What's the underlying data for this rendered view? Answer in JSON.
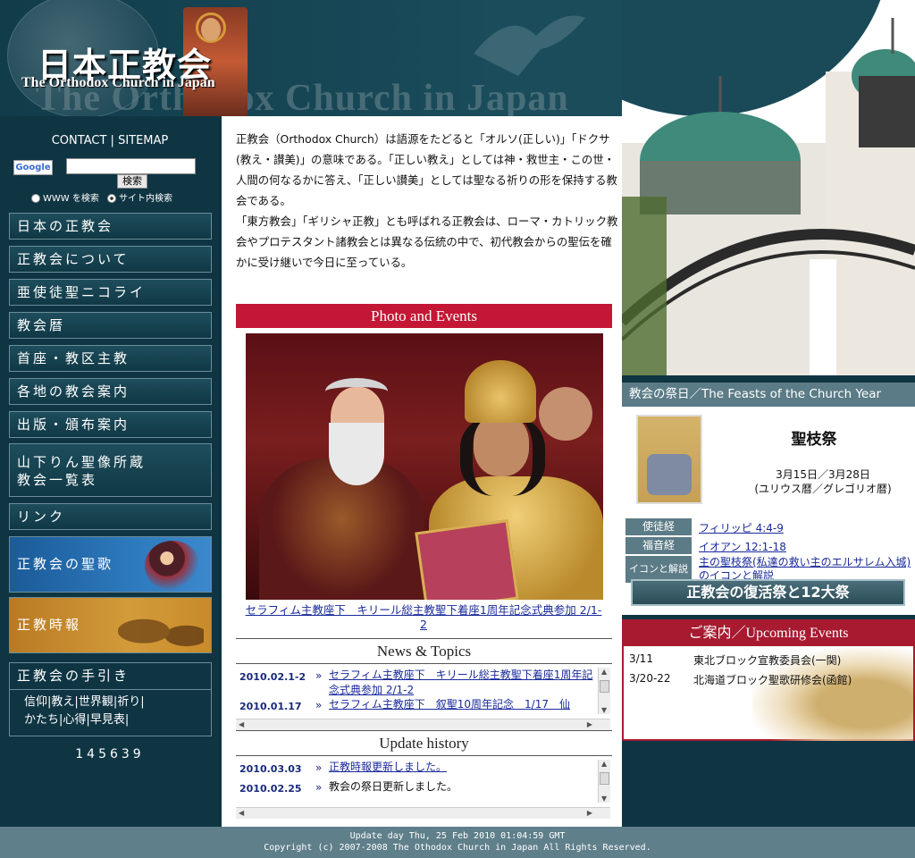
{
  "header": {
    "title_jp": "日本正教会",
    "title_en": "The Orthodox Church in Japan",
    "watermark": "The Orthodox Church in Japan"
  },
  "left_nav": {
    "contact": "CONTACT",
    "separator": "|",
    "sitemap": "SITEMAP",
    "google_logo": "Google",
    "search_value": "",
    "search_button": "検索",
    "radio_www": "WWW を検索",
    "radio_site": "サイト内検索",
    "items": [
      {
        "label": "日本の正教会"
      },
      {
        "label": "正教会について"
      },
      {
        "label": "亜使徒聖ニコライ"
      },
      {
        "label": "教会暦"
      },
      {
        "label": "首座・教区主教"
      },
      {
        "label": "各地の教会案内"
      },
      {
        "label": "出版・頒布案内"
      },
      {
        "label": "山下りん聖像所蔵"
      },
      {
        "label": "教会一覧表"
      },
      {
        "label": "リンク"
      },
      {
        "label": "正教会の聖歌"
      },
      {
        "label": "正教時報"
      }
    ],
    "guide": {
      "title": "正教会の手引き",
      "link1": "信仰",
      "link2": "教え",
      "link3": "世界観",
      "link4": "祈り",
      "link5": "かたち",
      "link6": "心得",
      "link7": "早見表",
      "sep": "|"
    },
    "counter": "145639"
  },
  "center": {
    "intro_p1": "正教会（Orthodox Church）は語源をたどると「オルソ(正しい)」「ドクサ(教え・讃美)」の意味である。「正しい教え」としては神・救世主・この世・人間の何なるかに答え、「正しい讃美」としては聖なる祈りの形を保持する教会である。",
    "intro_p2": "「東方教会」「ギリシャ正教」とも呼ばれる正教会は、ローマ・カトリック教会やプロテスタント諸教会とは異なる伝統の中で、初代教会からの聖伝を確かに受け継いで今日に至っている。",
    "photo_banner": "Photo and Events",
    "photo_caption": "セラフィム主教座下　キリール総主教聖下着座1周年記念式典参加 2/1-2",
    "news": {
      "title": "News & Topics",
      "rows": [
        {
          "date": "2010.02.1-2",
          "bullet": "»",
          "text": "セラフィム主教座下　キリール総主教聖下着座1周年記念式典参加 2/1-2"
        },
        {
          "date": "2010.01.17",
          "bullet": "»",
          "text": "セラフィム主教座下　叙聖10周年記念　1/17　仙"
        }
      ]
    },
    "updates": {
      "title": "Update history",
      "rows": [
        {
          "date": "2010.03.03",
          "bullet": "»",
          "text": "正教時報更新しました。"
        },
        {
          "date": "2010.02.25",
          "bullet": "»",
          "text": "教会の祭日更新しました。"
        }
      ]
    }
  },
  "feast": {
    "title": "教会の祭日／The Feasts of the Church Year",
    "name": "聖枝祭",
    "date1": "3月15日／3月28日",
    "date2": "(ユリウス暦／グレゴリオ暦)",
    "readings": [
      {
        "key": "使徒経",
        "value": "フィリッピ 4:4-9"
      },
      {
        "key": "福音経",
        "value": "イオアン 12:1-18"
      },
      {
        "key": "イコンと解説",
        "value": "主の聖枝祭(私達の救い主のエルサレム入城)のイコンと解説"
      }
    ],
    "pascha_button": "正教会の復活祭と12大祭"
  },
  "events": {
    "title": "ご案内／Upcoming Events",
    "rows": [
      {
        "date": "3/11",
        "text": "東北ブロック宣教委員会(一関)"
      },
      {
        "date": "3/20-22",
        "text": "北海道ブロック聖歌研修会(函館)"
      }
    ]
  },
  "footer": {
    "line1": "Update day   Thu, 25 Feb 2010 01:04:59 GMT",
    "line2": "Copyright (c) 2007-2008 The Othodox Church in Japan All Rights Reserved."
  },
  "colors": {
    "navy": "#0f3543",
    "banner_red": "#c41735",
    "events_red": "#a71a30",
    "teal": "#5b7b86",
    "link_blue": "#1a2a9a"
  }
}
